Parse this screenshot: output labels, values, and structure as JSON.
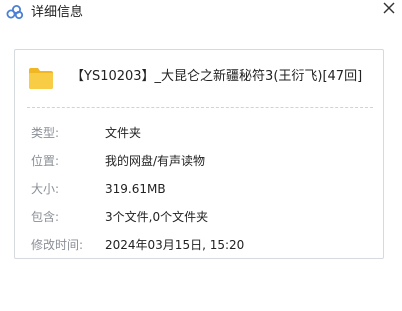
{
  "window": {
    "title": "详细信息",
    "app_icon": "cloud-link-icon",
    "close_icon": "close-icon"
  },
  "file": {
    "icon": "folder-icon",
    "name": "【YS10203】_大昆仑之新疆秘符3(王衍飞)[47回]"
  },
  "details": [
    {
      "label": "类型:",
      "value": "文件夹"
    },
    {
      "label": "位置:",
      "value": "我的网盘/有声读物"
    },
    {
      "label": "大小:",
      "value": "319.61MB"
    },
    {
      "label": "包含:",
      "value": "3个文件,0个文件夹"
    },
    {
      "label": "修改时间:",
      "value": "2024年03月15日, 15:20"
    }
  ],
  "colors": {
    "folder": "#f5c02f",
    "label": "#8a8f96",
    "icon": "#4a7fd6"
  }
}
